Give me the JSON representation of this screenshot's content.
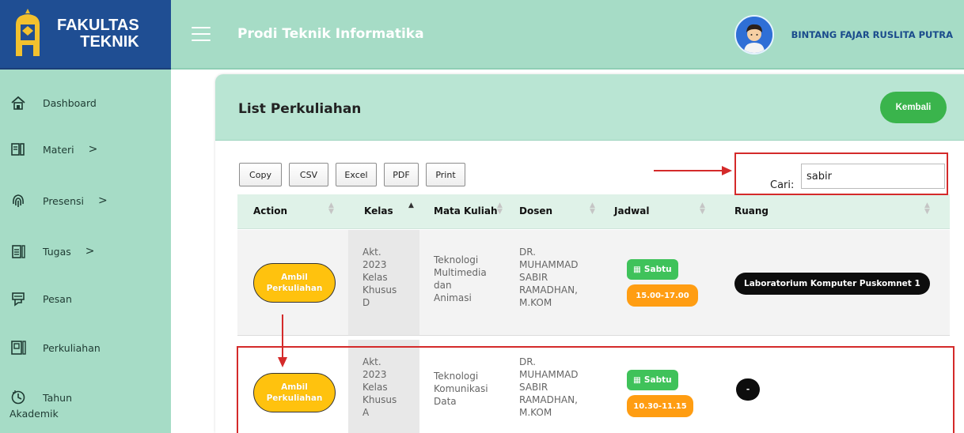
{
  "header": {
    "brand_line1": "FAKULTAS",
    "brand_line2": "TEKNIK",
    "prodi_title": "Prodi Teknik Informatika",
    "user_name": "BINTANG FAJAR RUSLITA PUTRA"
  },
  "sidebar": {
    "items": [
      {
        "label": "Dashboard",
        "icon": "home-icon"
      },
      {
        "label": "Materi",
        "icon": "book-icon",
        "chevron": ">"
      },
      {
        "label": "Presensi",
        "icon": "fingerprint-icon",
        "chevron": ">"
      },
      {
        "label": "Tugas",
        "icon": "clipboard-icon",
        "chevron": ">"
      },
      {
        "label": "Pesan",
        "icon": "message-icon"
      },
      {
        "label": "Perkuliahan",
        "icon": "classroom-icon"
      },
      {
        "label_line1": "Tahun",
        "label_line2": "Akademik",
        "icon": "calendar-clock-icon"
      }
    ]
  },
  "main": {
    "title": "List Perkuliahan",
    "back_button": "Kembali",
    "export_buttons": [
      "Copy",
      "CSV",
      "Excel",
      "PDF",
      "Print"
    ],
    "search": {
      "label": "Cari:",
      "value": "sabir"
    },
    "columns": [
      "Action",
      "Kelas",
      "Mata Kuliah",
      "Dosen",
      "Jadwal",
      "Ruang"
    ],
    "rows": [
      {
        "action": "Ambil Perkuliahan",
        "kelas": [
          "Akt.",
          "2023",
          "Kelas",
          "Khusus",
          "D"
        ],
        "mata_kuliah": [
          "Teknologi",
          "Multimedia",
          "dan",
          "Animasi"
        ],
        "dosen": [
          "DR.",
          "MUHAMMAD",
          "SABIR",
          "RAMADHAN,",
          "M.KOM"
        ],
        "hari": "Sabtu",
        "waktu": "15.00-17.00",
        "ruang": "Laboratorium Komputer Puskomnet 1"
      },
      {
        "action": "Ambil Perkuliahan",
        "kelas": [
          "Akt.",
          "2023",
          "Kelas",
          "Khusus",
          "A"
        ],
        "mata_kuliah": [
          "Teknologi",
          "Komunikasi",
          "Data"
        ],
        "dosen": [
          "DR.",
          "MUHAMMAD",
          "SABIR",
          "RAMADHAN,",
          "M.KOM"
        ],
        "hari": "Sabtu",
        "waktu": "10.30-11.15",
        "ruang": "-"
      }
    ]
  },
  "colors": {
    "brand_blue": "#1f4e93",
    "mint": "#a6dcc6",
    "green": "#3ab44c",
    "yellow": "#ffc20e",
    "orange": "#ff9d12",
    "highlight_red": "#d42a2a"
  }
}
